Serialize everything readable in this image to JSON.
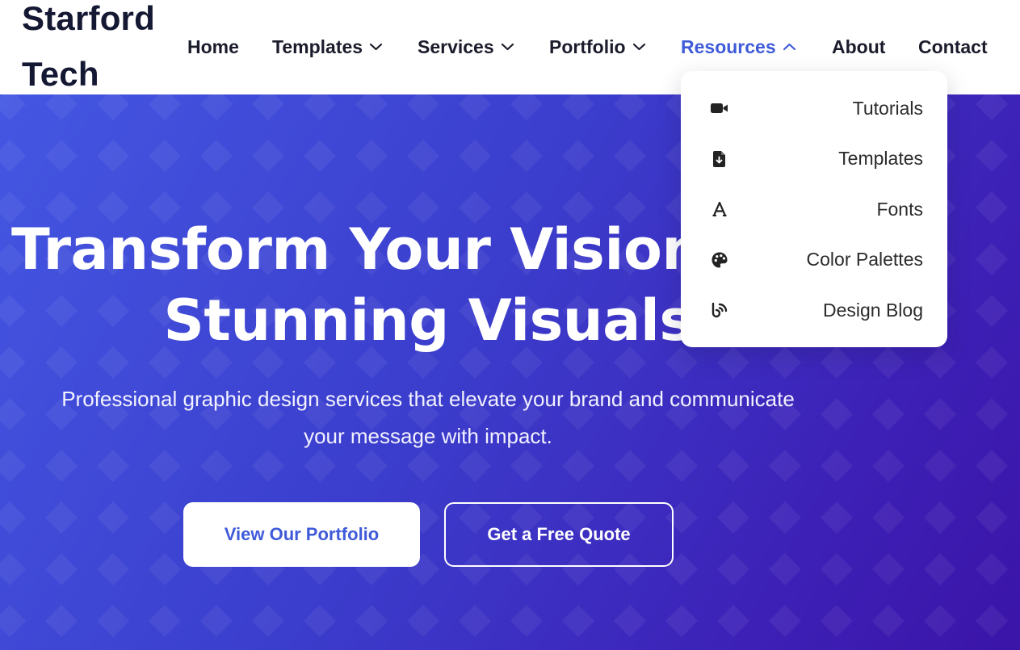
{
  "header": {
    "brand": "Starford Tech"
  },
  "nav": {
    "items": [
      {
        "label": "Home"
      },
      {
        "label": "Templates"
      },
      {
        "label": "Services"
      },
      {
        "label": "Portfolio"
      },
      {
        "label": "Resources"
      },
      {
        "label": "About"
      },
      {
        "label": "Contact"
      }
    ],
    "active": "Resources"
  },
  "resources_menu": {
    "items": [
      {
        "label": "Tutorials",
        "icon": "video-camera-icon"
      },
      {
        "label": "Templates",
        "icon": "file-download-icon"
      },
      {
        "label": "Fonts",
        "icon": "font-icon"
      },
      {
        "label": "Color Palettes",
        "icon": "palette-icon"
      },
      {
        "label": "Design Blog",
        "icon": "blog-icon"
      }
    ]
  },
  "hero": {
    "title_line1": "Transform Your Vision into",
    "title_line2": "Stunning Visuals",
    "subtitle_line1": "Professional graphic design services that elevate your brand and communicate",
    "subtitle_line2": "your message with impact.",
    "primary_button": "View Our Portfolio",
    "secondary_button": "Get a Free Quote"
  },
  "colors": {
    "accent": "#3f5bd9",
    "nav_text": "#1b1c2b",
    "hero_gradient_start": "#4457e2",
    "hero_gradient_end": "#3b14a8"
  }
}
